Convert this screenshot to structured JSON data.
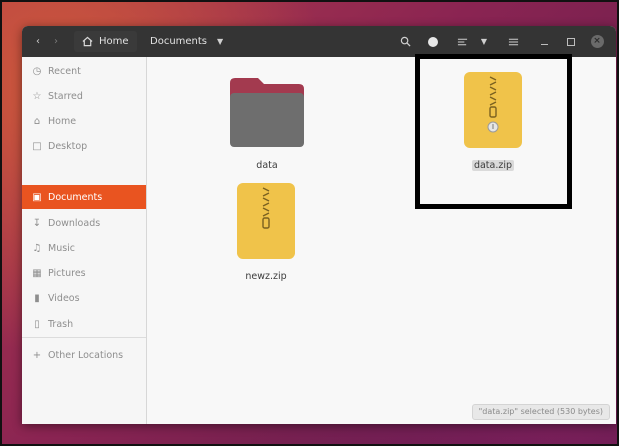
{
  "headerbar": {
    "path_home": "Home",
    "path_current": "Documents"
  },
  "sidebar": {
    "items": [
      {
        "label": "Recent",
        "icon": "clock-icon"
      },
      {
        "label": "Starred",
        "icon": "star-icon"
      },
      {
        "label": "Home",
        "icon": "home-icon"
      },
      {
        "label": "Desktop",
        "icon": "desktop-icon"
      },
      {
        "label": "Documents",
        "icon": "document-icon",
        "active": true
      },
      {
        "label": "Downloads",
        "icon": "download-icon"
      },
      {
        "label": "Music",
        "icon": "music-icon"
      },
      {
        "label": "Pictures",
        "icon": "picture-icon"
      },
      {
        "label": "Videos",
        "icon": "video-icon"
      },
      {
        "label": "Trash",
        "icon": "trash-icon"
      },
      {
        "label": "Other Locations",
        "icon": "plus-icon"
      }
    ]
  },
  "files": [
    {
      "name": "data",
      "type": "folder"
    },
    {
      "name": "data.zip",
      "type": "zip",
      "selected": true
    },
    {
      "name": "newz.zip",
      "type": "zip"
    }
  ],
  "status": {
    "text": "\"data.zip\" selected (530 bytes)"
  },
  "colors": {
    "accent": "#e95420",
    "headerbar": "#343434",
    "zip_yellow": "#f0c34a",
    "folder_gray": "#6e6e6e",
    "folder_tab": "#a33a4f"
  }
}
